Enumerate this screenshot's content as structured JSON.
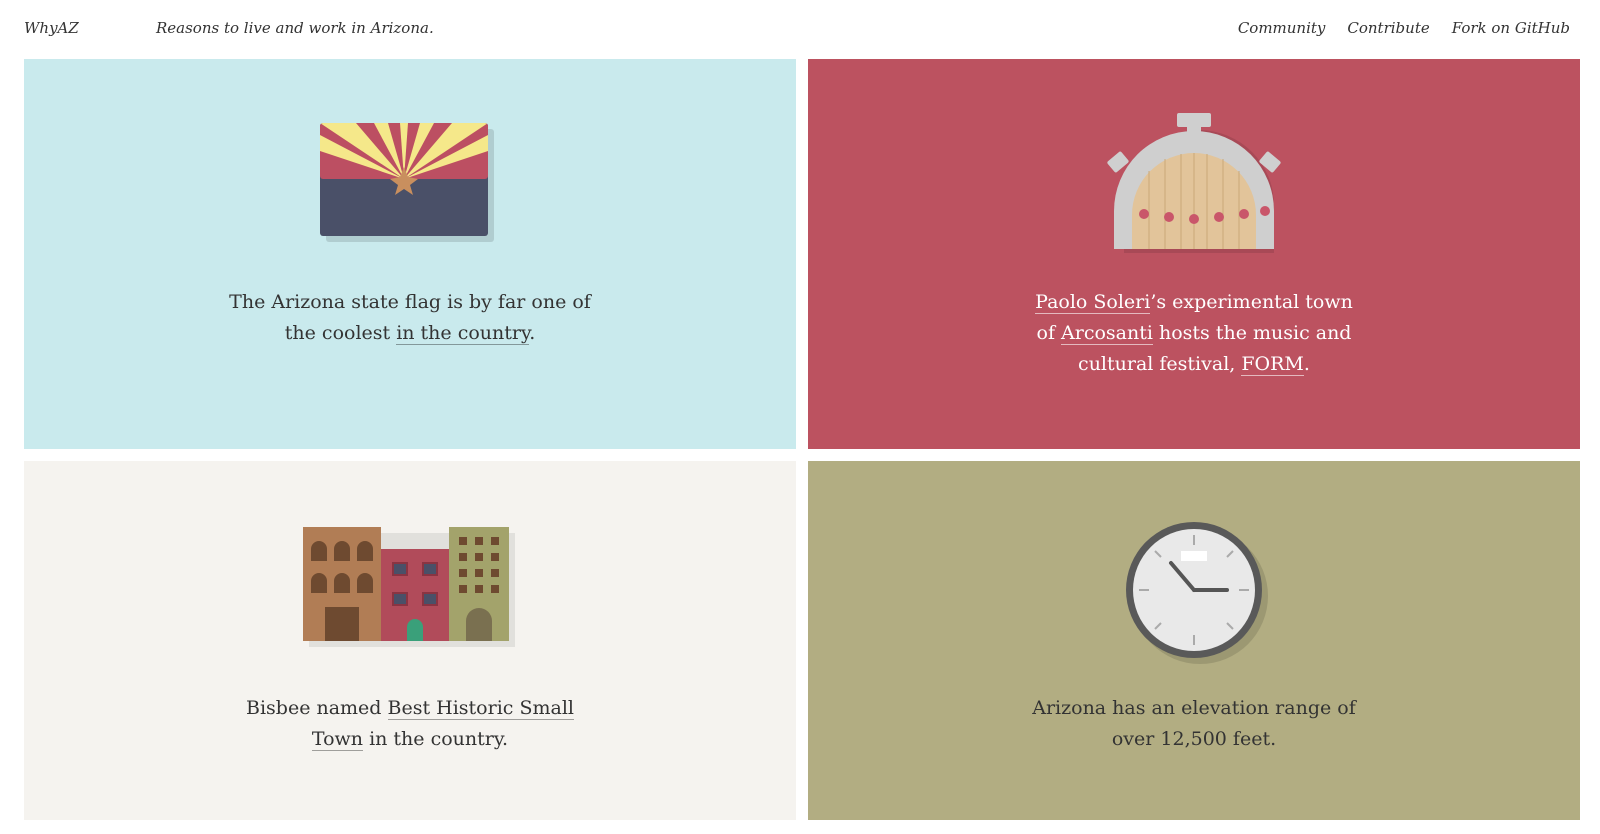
{
  "header": {
    "logo": "WhyAZ",
    "tagline": "Reasons to live and work in Arizona.",
    "nav": [
      {
        "label": "Community"
      },
      {
        "label": "Contribute"
      },
      {
        "label": "Fork on GitHub"
      }
    ]
  },
  "cards": [
    {
      "bg": "#c9eaed",
      "icon": "arizona-flag-icon",
      "text_before": "The Arizona state flag is by far one of the coolest ",
      "link": "in the country",
      "text_after": "."
    },
    {
      "bg": "#bc5260",
      "icon": "arcosanti-dome-icon",
      "link1": "Paolo Soleri",
      "text1": "’s experimental town of ",
      "link2": "Arcosanti",
      "text2": " hosts the music and cultural festival, ",
      "link3": "FORM",
      "text3": "."
    },
    {
      "bg": "#f5f3ef",
      "icon": "historic-buildings-icon",
      "text_before": "Bisbee named ",
      "link": "Best Historic Small Town",
      "text_after": " in the country."
    },
    {
      "bg": "#b2ad82",
      "icon": "clock-icon",
      "text": "Arizona has an elevation range of over 12,500 feet."
    }
  ]
}
